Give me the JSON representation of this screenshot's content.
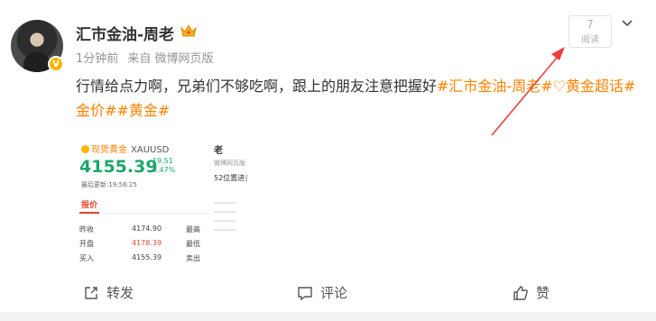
{
  "post": {
    "author": "汇市金油-周老",
    "verified_badge": "V",
    "time": "1分钟前",
    "source": "来自 微博网页版",
    "read_count": "7",
    "read_label": "阅读",
    "text_plain": "行情给点力啊，兄弟们不够吃啊，跟上的朋友注意把握好",
    "tag_author": "#汇市金油-周老#",
    "tag_super": "♡黄金超话",
    "tag_gold_price": "#金价#",
    "tag_gold": "#黄金#"
  },
  "thumbnail": {
    "instrument_cn": "现货黄金",
    "symbol": "XAUUSD",
    "price": "4155.39",
    "change": "-19.51",
    "change_pct": "-0.47%",
    "updated": "最后更新:19:56:25",
    "tab": "报价",
    "rows": [
      {
        "k": "昨收",
        "v": "4174.90",
        "k2": "最高",
        "red": false
      },
      {
        "k": "开盘",
        "v": "4178.39",
        "k2": "最低",
        "red": true
      },
      {
        "k": "买入",
        "v": "4155.39",
        "k2": "卖出",
        "red": false
      }
    ],
    "side_name": "老",
    "side_source": "微博网页版",
    "side_text": "52位置进多，防守4146，目标看百点"
  },
  "actions": {
    "repost": "转发",
    "comment": "评论",
    "like": "赞"
  },
  "colors": {
    "tag": "#ff8200",
    "price_green": "#1aa86b",
    "arrow_red": "#e8403a"
  }
}
